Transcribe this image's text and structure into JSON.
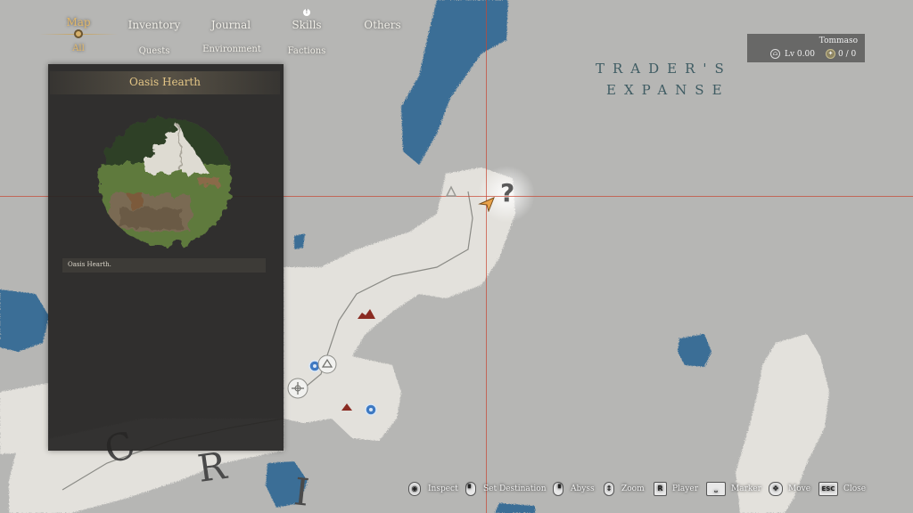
{
  "nav": {
    "tabs": [
      {
        "label": "Map",
        "active": true
      },
      {
        "label": "Inventory"
      },
      {
        "label": "Journal"
      },
      {
        "label": "Skills"
      },
      {
        "label": "Others"
      }
    ],
    "subtabs": [
      {
        "label": "All",
        "active": true
      },
      {
        "label": "Quests"
      },
      {
        "label": "Environment"
      },
      {
        "label": "Factions"
      }
    ]
  },
  "player": {
    "name": "Tommaso",
    "level": "Lv 0.00",
    "resource": "0 / 0"
  },
  "region": {
    "line1": "TRADER'S",
    "line2": "EXPANSE",
    "partial_name_letters": [
      "C",
      "R",
      "I"
    ]
  },
  "panel": {
    "title": "Oasis Hearth",
    "description": "Oasis Hearth."
  },
  "map_markers": {
    "unknown_poi": "?"
  },
  "hints": [
    {
      "key": "mouse-drag",
      "label": "Inspect"
    },
    {
      "key": "mouse-left",
      "label": "Set Destination"
    },
    {
      "key": "mouse-right",
      "label": "Abyss"
    },
    {
      "key": "scroll",
      "label": "Zoom"
    },
    {
      "key": "R",
      "label": "Player"
    },
    {
      "key": "space",
      "label": "Marker"
    },
    {
      "key": "wasd",
      "label": "Move"
    },
    {
      "key": "ESC",
      "label": "Close"
    }
  ],
  "colors": {
    "accent_gold": "#e2b86a",
    "panel_bg": "#262523",
    "water": "#3a6e96",
    "land": "#e3e1dc",
    "fog": "#b3b3b1",
    "crosshair": "#c84632",
    "player_arrow": "#e8a24a"
  }
}
